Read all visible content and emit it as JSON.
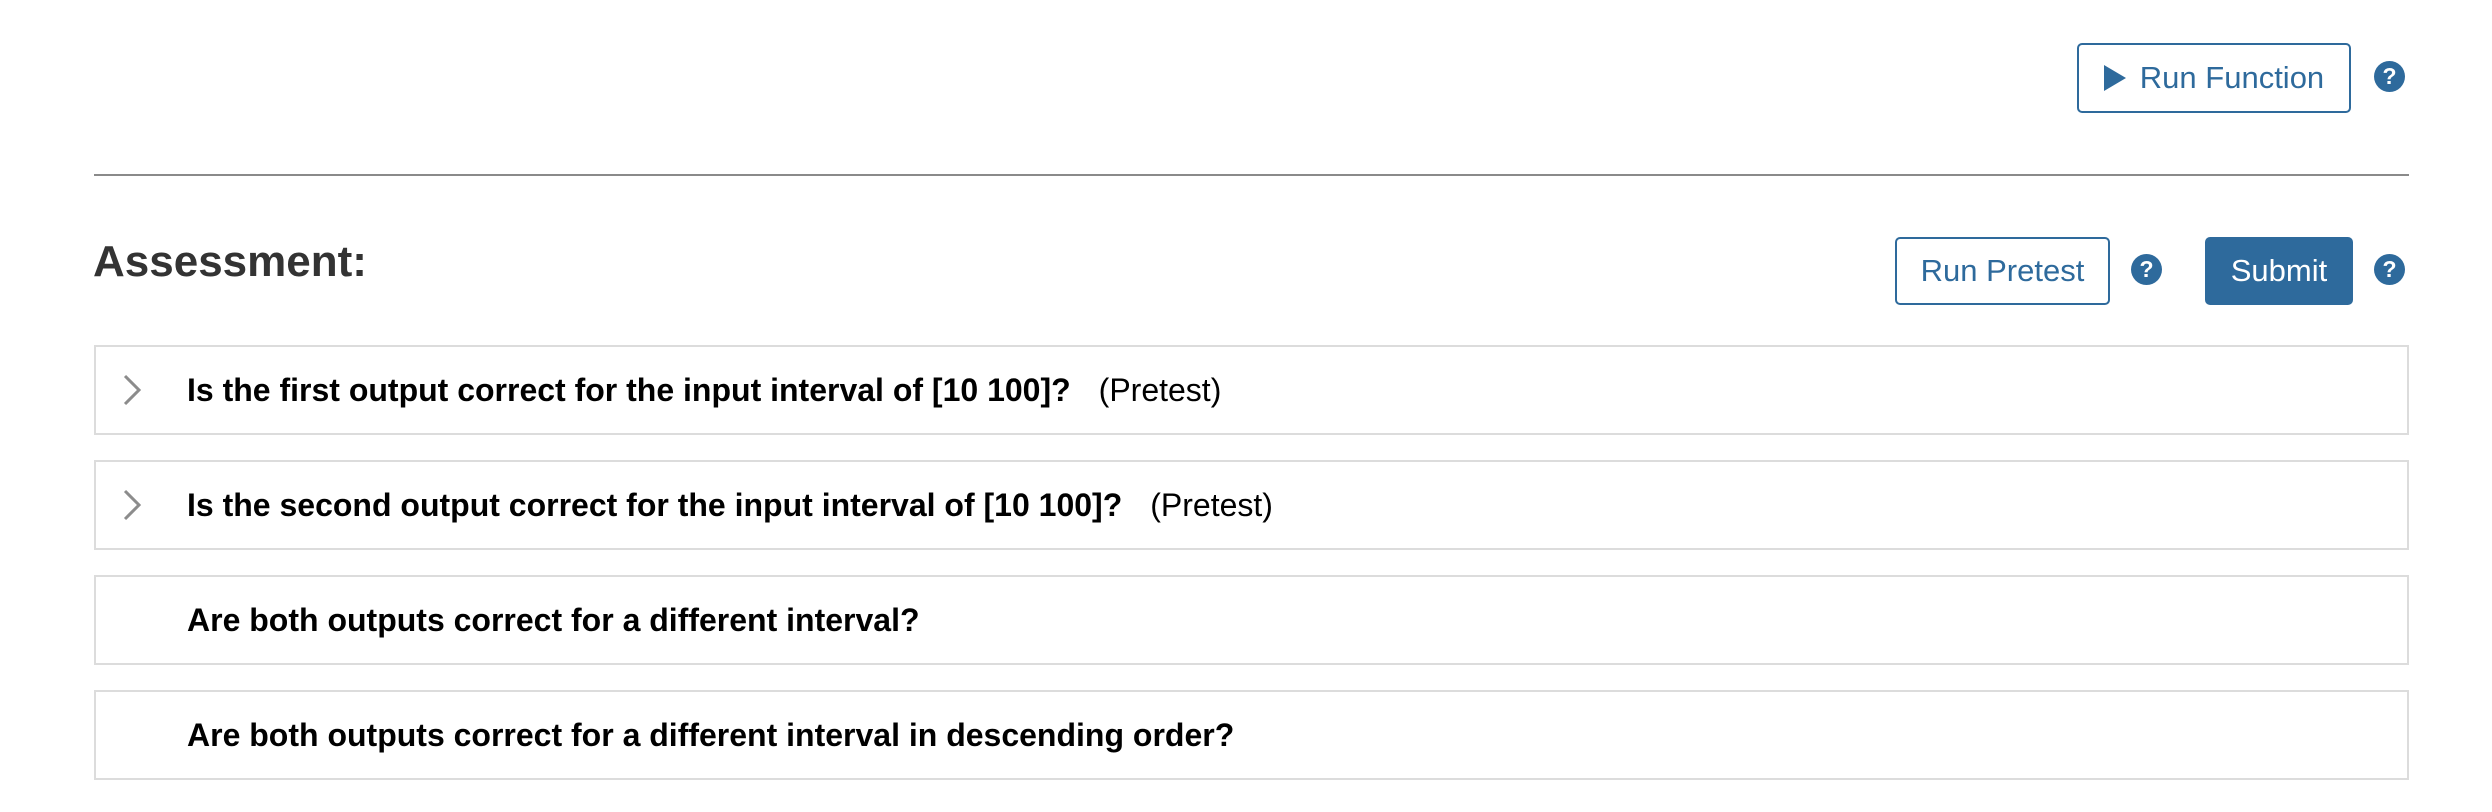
{
  "toolbar": {
    "run_function_label": "Run Function",
    "help_icon_glyph": "?"
  },
  "assessment": {
    "title": "Assessment:",
    "run_pretest_label": "Run Pretest",
    "submit_label": "Submit",
    "help_icon_glyph": "?",
    "items": [
      {
        "question": "Is the first output correct for the input interval of [10 100]?",
        "tag": "(Pretest)",
        "expandable": true
      },
      {
        "question": "Is the second output correct for the input interval of [10 100]?",
        "tag": "(Pretest)",
        "expandable": true
      },
      {
        "question": "Are both outputs correct for a different interval?",
        "tag": "",
        "expandable": false
      },
      {
        "question": "Are both outputs correct for a different interval in descending order?",
        "tag": "",
        "expandable": false
      }
    ]
  },
  "colors": {
    "accent": "#2e6a9c",
    "divider": "#8a8a8a",
    "border": "#dcdcdc",
    "chevron": "#8c8c8c"
  },
  "icons": [
    "play-icon",
    "help-icon",
    "chevron-right-icon"
  ]
}
